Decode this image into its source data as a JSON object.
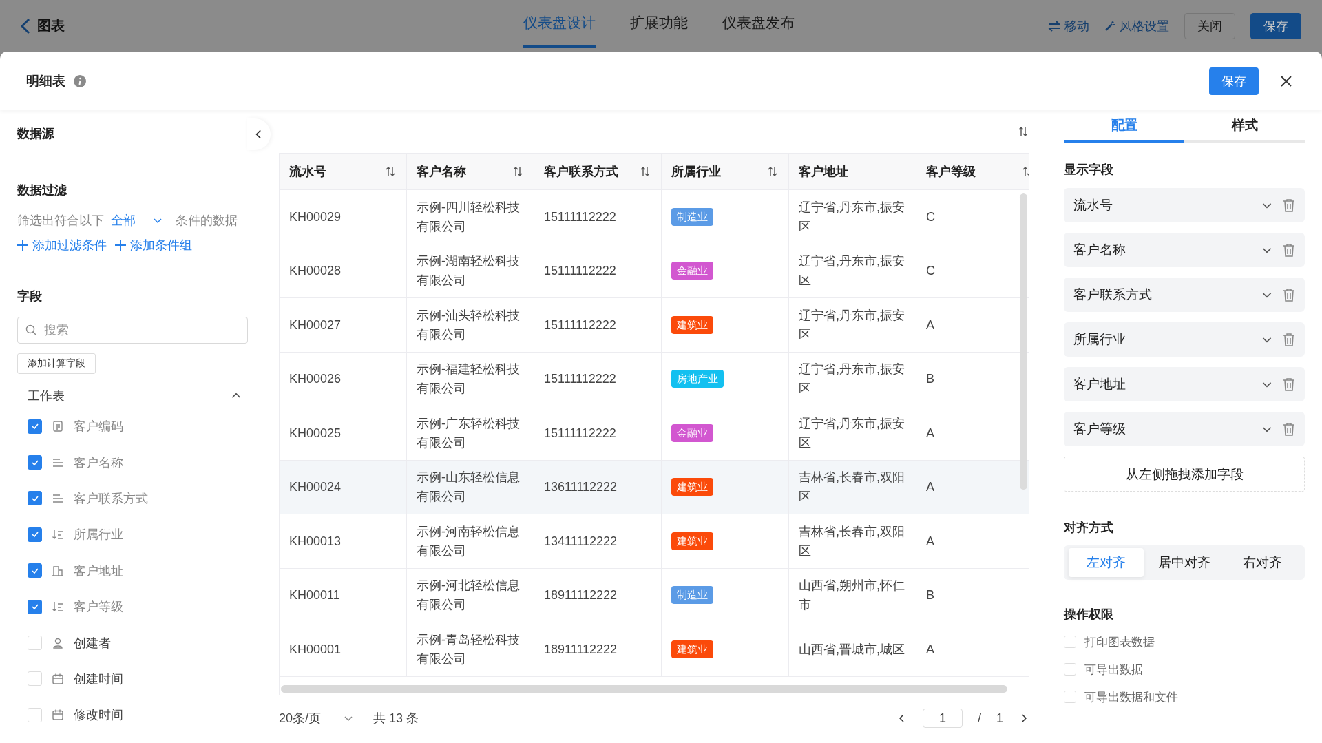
{
  "top_bar": {
    "back_label": "图表",
    "tabs": [
      {
        "label": "仪表盘设计",
        "selected": true
      },
      {
        "label": "扩展功能",
        "selected": false
      },
      {
        "label": "仪表盘发布",
        "selected": false
      }
    ],
    "actions": [
      {
        "label": "移动",
        "kind": "link"
      },
      {
        "label": "风格设置",
        "kind": "link"
      },
      {
        "label": "关闭",
        "kind": "button"
      },
      {
        "label": "保存",
        "kind": "primary"
      }
    ]
  },
  "dialog": {
    "title": "明细表",
    "save": "保存"
  },
  "left_panel": {
    "datasource_heading": "数据源",
    "filter_heading": "数据过滤",
    "filter_prefix": "筛选出符合以下",
    "filter_mode": "全部",
    "filter_suffix": "条件的数据",
    "add_links": [
      "添加过滤条件",
      "添加条件组"
    ],
    "fields_heading": "字段",
    "search_placeholder": "搜索",
    "add_calc_button": "添加计算字段",
    "group": {
      "label": "工作表",
      "expanded": true
    },
    "fields": [
      {
        "label": "客户编码",
        "checked": true,
        "kind": "code"
      },
      {
        "label": "客户名称",
        "checked": true,
        "kind": "text"
      },
      {
        "label": "客户联系方式",
        "checked": true,
        "kind": "text"
      },
      {
        "label": "所属行业",
        "checked": true,
        "kind": "option"
      },
      {
        "label": "客户地址",
        "checked": true,
        "kind": "address"
      },
      {
        "label": "客户等级",
        "checked": true,
        "kind": "option"
      },
      {
        "label": "创建者",
        "checked": false,
        "kind": "user"
      },
      {
        "label": "创建时间",
        "checked": false,
        "kind": "date"
      },
      {
        "label": "修改时间",
        "checked": false,
        "kind": "date"
      }
    ]
  },
  "table": {
    "columns": [
      {
        "label": "流水号",
        "sortable": true
      },
      {
        "label": "客户名称",
        "sortable": true
      },
      {
        "label": "客户联系方式",
        "sortable": true
      },
      {
        "label": "所属行业",
        "sortable": true
      },
      {
        "label": "客户地址",
        "sortable": false
      },
      {
        "label": "客户等级",
        "sortable": true
      }
    ],
    "rows": [
      {
        "serial": "KH00029",
        "name": "示例-四川轻松科技有限公司",
        "phone": "15111112222",
        "industry": {
          "label": "制造业",
          "color": "#5b9be6"
        },
        "address": "辽宁省,丹东市,振安区",
        "level": "C",
        "hovered": false
      },
      {
        "serial": "KH00028",
        "name": "示例-湖南轻松科技有限公司",
        "phone": "15111112222",
        "industry": {
          "label": "金融业",
          "color": "#d257d0"
        },
        "address": "辽宁省,丹东市,振安区",
        "level": "C",
        "hovered": false
      },
      {
        "serial": "KH00027",
        "name": "示例-汕头轻松科技有限公司",
        "phone": "15111112222",
        "industry": {
          "label": "建筑业",
          "color": "#fb4a0a"
        },
        "address": "辽宁省,丹东市,振安区",
        "level": "A",
        "hovered": false
      },
      {
        "serial": "KH00026",
        "name": "示例-福建轻松科技有限公司",
        "phone": "15111112222",
        "industry": {
          "label": "房地产业",
          "color": "#13c0f0"
        },
        "address": "辽宁省,丹东市,振安区",
        "level": "B",
        "hovered": false
      },
      {
        "serial": "KH00025",
        "name": "示例-广东轻松科技有限公司",
        "phone": "15111112222",
        "industry": {
          "label": "金融业",
          "color": "#d257d0"
        },
        "address": "辽宁省,丹东市,振安区",
        "level": "A",
        "hovered": false
      },
      {
        "serial": "KH00024",
        "name": "示例-山东轻松信息有限公司",
        "phone": "13611112222",
        "industry": {
          "label": "建筑业",
          "color": "#fb4a0a"
        },
        "address": "吉林省,长春市,双阳区",
        "level": "A",
        "hovered": true
      },
      {
        "serial": "KH00013",
        "name": "示例-河南轻松信息有限公司",
        "phone": "13411112222",
        "industry": {
          "label": "建筑业",
          "color": "#fb4a0a"
        },
        "address": "吉林省,长春市,双阳区",
        "level": "A",
        "hovered": false
      },
      {
        "serial": "KH00011",
        "name": "示例-河北轻松信息有限公司",
        "phone": "18911112222",
        "industry": {
          "label": "制造业",
          "color": "#5b9be6"
        },
        "address": "山西省,朔州市,怀仁市",
        "level": "B",
        "hovered": false
      },
      {
        "serial": "KH00001",
        "name": "示例-青岛轻松科技有限公司",
        "phone": "18911112222",
        "industry": {
          "label": "建筑业",
          "color": "#fb4a0a"
        },
        "address": "山西省,晋城市,城区",
        "level": "A",
        "hovered": false
      }
    ]
  },
  "pagination": {
    "page_size": "20条/页",
    "total": "共 13 条",
    "page": "1",
    "separator": "/",
    "pages": "1"
  },
  "right_panel": {
    "tabs": [
      {
        "label": "配置",
        "selected": true
      },
      {
        "label": "样式",
        "selected": false
      }
    ],
    "display_heading": "显示字段",
    "display_fields": [
      "流水号",
      "客户名称",
      "客户联系方式",
      "所属行业",
      "客户地址",
      "客户等级"
    ],
    "drop_hint": "从左侧拖拽添加字段",
    "align_heading": "对齐方式",
    "align_options": [
      {
        "label": "左对齐",
        "selected": true
      },
      {
        "label": "居中对齐",
        "selected": false
      },
      {
        "label": "右对齐",
        "selected": false
      }
    ],
    "permissions_heading": "操作权限",
    "permissions": [
      {
        "label": "打印图表数据",
        "checked": false
      },
      {
        "label": "可导出数据",
        "checked": false
      },
      {
        "label": "可导出数据和文件",
        "checked": false
      }
    ]
  }
}
